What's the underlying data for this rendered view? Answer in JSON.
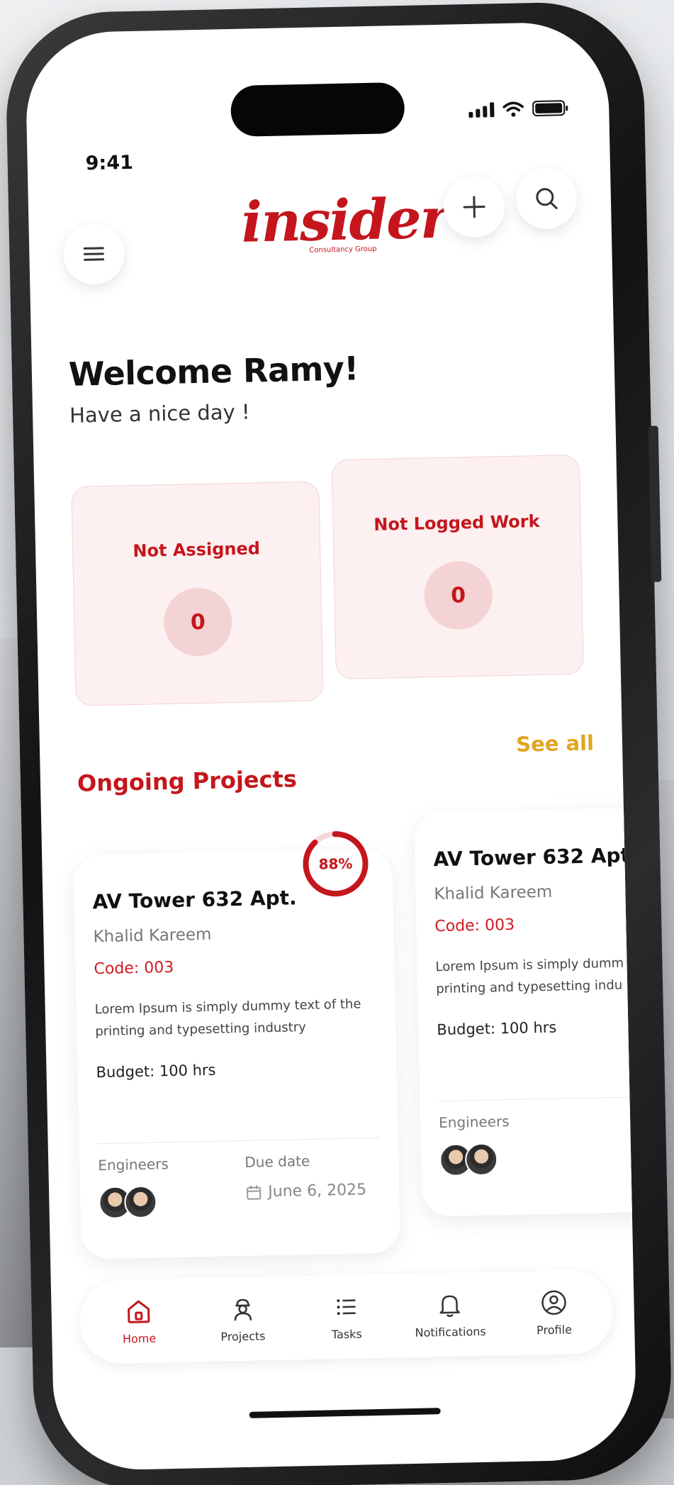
{
  "status": {
    "time": "9:41"
  },
  "brand": {
    "name": "insider",
    "tagline": "Consultancy Group"
  },
  "welcome": {
    "title": "Welcome Ramy!",
    "subtitle": "Have a nice day !"
  },
  "stats": [
    {
      "label": "Not Assigned",
      "value": "0"
    },
    {
      "label": "Not Logged Work",
      "value": "0"
    }
  ],
  "ongoing": {
    "title": "Ongoing Projects",
    "see_all": "See all"
  },
  "projects": [
    {
      "title": "AV Tower 632 Apt.",
      "owner": "Khalid Kareem",
      "code": "Code: 003",
      "desc_line1": "Lorem Ipsum is simply dummy text of the",
      "desc_line2": "printing and typesetting industry",
      "budget": "Budget: 100 hrs",
      "engineers_label": "Engineers",
      "due_label": "Due date",
      "due_date": "June 6, 2025",
      "progress": "88%",
      "progress_fraction": 0.88
    },
    {
      "title": "AV Tower 632 Apt.",
      "owner": "Khalid Kareem",
      "code": "Code: 003",
      "desc_line1": "Lorem Ipsum is simply dumm",
      "desc_line2": "printing and typesetting indu",
      "budget": "Budget: 100 hrs",
      "engineers_label": "Engineers"
    }
  ],
  "nav": [
    {
      "label": "Home",
      "icon": "home-icon",
      "active": true
    },
    {
      "label": "Projects",
      "icon": "engineer-icon"
    },
    {
      "label": "Tasks",
      "icon": "list-icon"
    },
    {
      "label": "Notifications",
      "icon": "bell-icon"
    },
    {
      "label": "Profile",
      "icon": "user-circle-icon"
    }
  ],
  "colors": {
    "brand_red": "#c4161c",
    "accent_yellow": "#e2a521",
    "stat_bg": "#fdf0f0"
  }
}
